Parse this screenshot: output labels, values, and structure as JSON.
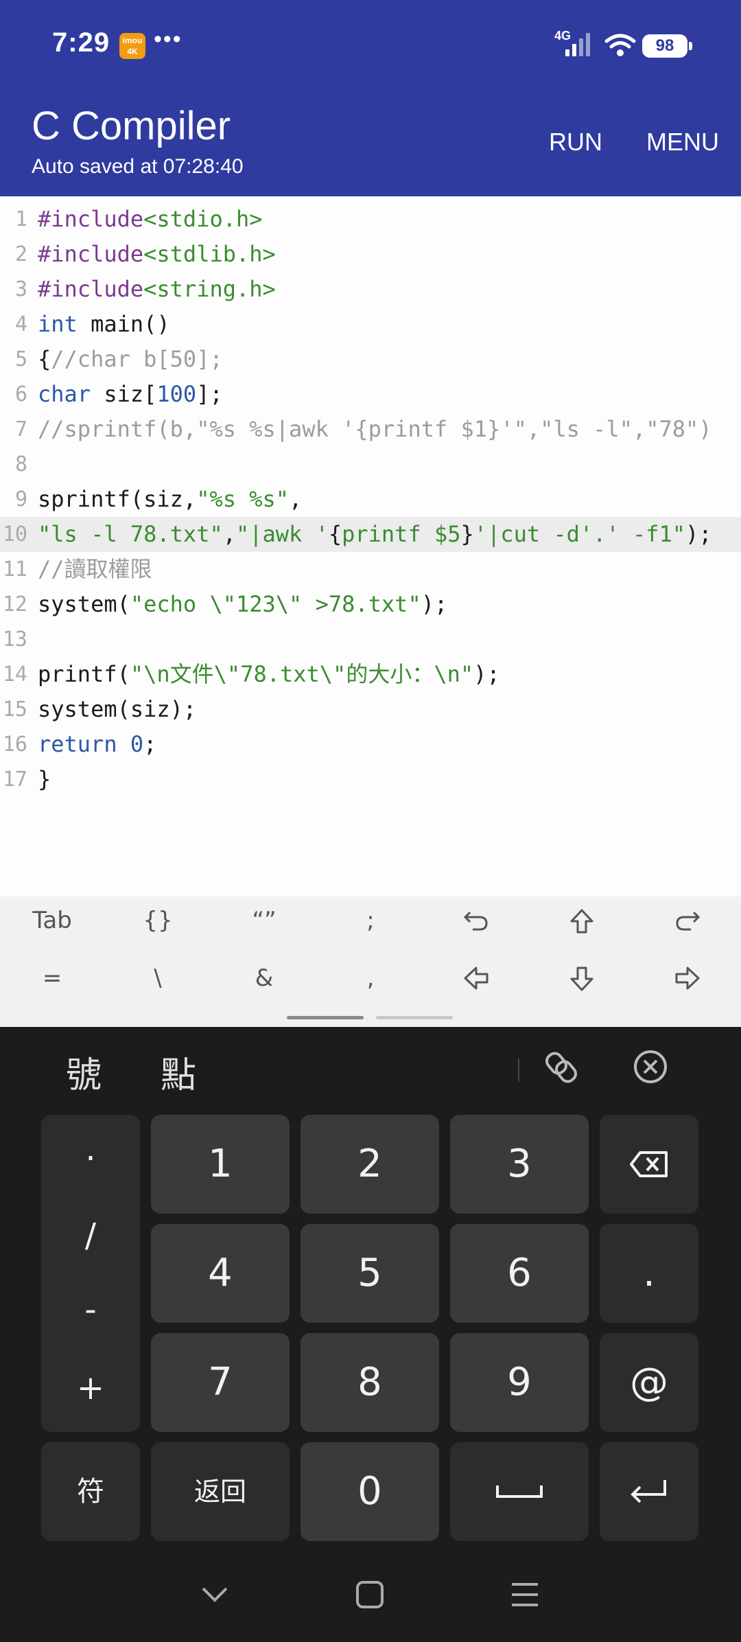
{
  "status": {
    "time": "7:29",
    "badge": "imou 4K",
    "dots": "•••",
    "network": "4G",
    "battery": "98"
  },
  "appbar": {
    "title": "C Compiler",
    "subtitle": "Auto saved at 07:28:40",
    "run": "RUN",
    "menu": "MENU"
  },
  "editor": {
    "current_line": 10,
    "lines": [
      {
        "n": "1",
        "t": [
          [
            "kw-pre",
            "#include"
          ],
          [
            "str",
            "<stdio.h>"
          ]
        ]
      },
      {
        "n": "2",
        "t": [
          [
            "kw-pre",
            "#include"
          ],
          [
            "str",
            "<stdlib.h>"
          ]
        ]
      },
      {
        "n": "3",
        "t": [
          [
            "kw-pre",
            "#include"
          ],
          [
            "str",
            "<string.h>"
          ]
        ]
      },
      {
        "n": "4",
        "t": [
          [
            "kw",
            "int"
          ],
          [
            "plain",
            " main()"
          ]
        ]
      },
      {
        "n": "5",
        "t": [
          [
            "plain",
            "{"
          ],
          [
            "cmt",
            "//char b[50];"
          ]
        ]
      },
      {
        "n": "6",
        "t": [
          [
            "kw",
            "char"
          ],
          [
            "plain",
            " siz["
          ],
          [
            "num",
            "100"
          ],
          [
            "plain",
            "];"
          ]
        ]
      },
      {
        "n": "7",
        "t": [
          [
            "cmt",
            "//sprintf(b,\"%s %s|awk '{printf $1}'\",\"ls -l\",\"78\")"
          ]
        ]
      },
      {
        "n": "8",
        "t": []
      },
      {
        "n": "9",
        "t": [
          [
            "plain",
            "sprintf(siz,"
          ],
          [
            "str",
            "\"%s %s\""
          ],
          [
            "plain",
            ","
          ]
        ]
      },
      {
        "n": "10",
        "t": [
          [
            "str",
            "\"ls -l 78.txt\""
          ],
          [
            "plain",
            ","
          ],
          [
            "str",
            "\"|awk '"
          ],
          [
            "plain",
            "{"
          ],
          [
            "str",
            "printf $5"
          ],
          [
            "plain",
            "}"
          ],
          [
            "str",
            "'|cut -d'.' -f1\""
          ],
          [
            "plain",
            ");"
          ]
        ]
      },
      {
        "n": "11",
        "t": [
          [
            "cmt",
            "//讀取權限"
          ]
        ]
      },
      {
        "n": "12",
        "t": [
          [
            "plain",
            "system("
          ],
          [
            "str",
            "\"echo \\\"123\\\" >78.txt\""
          ],
          [
            "plain",
            ");"
          ]
        ]
      },
      {
        "n": "13",
        "t": []
      },
      {
        "n": "14",
        "t": [
          [
            "plain",
            "printf("
          ],
          [
            "str",
            "\"\\n文件\\\"78.txt\\\"的大小：\\n\""
          ],
          [
            "plain",
            ");"
          ]
        ]
      },
      {
        "n": "15",
        "t": [
          [
            "plain",
            "system(siz);"
          ]
        ]
      },
      {
        "n": "16",
        "t": [
          [
            "kw",
            "return"
          ],
          [
            "plain",
            " "
          ],
          [
            "num",
            "0"
          ],
          [
            "plain",
            ";"
          ]
        ]
      },
      {
        "n": "17",
        "t": [
          [
            "plain",
            "}"
          ]
        ]
      }
    ]
  },
  "symbols": {
    "row1": [
      "Tab",
      "{}",
      "“”",
      ";"
    ],
    "row2": [
      "=",
      "\\",
      "&",
      ","
    ]
  },
  "keyboard": {
    "candidates": [
      "號",
      "點"
    ],
    "side_keys": [
      "·",
      "/",
      "-",
      "+"
    ],
    "numbers": [
      "1",
      "2",
      "3",
      "4",
      "5",
      "6",
      "7",
      "8",
      "9",
      "0"
    ],
    "period": ".",
    "at": "@",
    "symbol_key": "符",
    "back_key": "返回"
  },
  "colors": {
    "appbar": "#2f3b9f",
    "string": "#3a8c2f",
    "keyword": "#2b57a6",
    "preprocessor": "#7a3b8f",
    "comment": "#9c9c9c",
    "keyboard_bg": "#1c1c1e",
    "key_bg": "#3a3a3c"
  }
}
